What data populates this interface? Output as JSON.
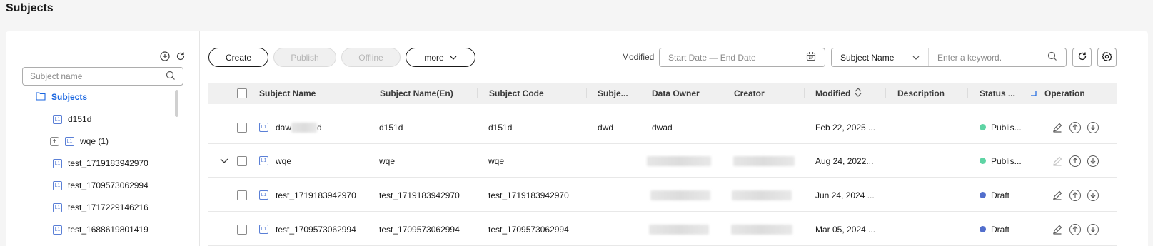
{
  "page": {
    "title": "Subjects"
  },
  "tree": {
    "search_placeholder": "Subject name",
    "root_label": "Subjects",
    "nodes": [
      {
        "label": "d151d",
        "expandable": false
      },
      {
        "label": "wqe (1)",
        "expandable": true
      },
      {
        "label": "test_1719183942970",
        "expandable": false
      },
      {
        "label": "test_1709573062994",
        "expandable": false
      },
      {
        "label": "test_1717229146216",
        "expandable": false
      },
      {
        "label": "test_1688619801419",
        "expandable": false
      }
    ],
    "node_icon_text": "L1"
  },
  "toolbar": {
    "create_label": "Create",
    "publish_label": "Publish",
    "offline_label": "Offline",
    "more_label": "more",
    "modified_label": "Modified",
    "date_placeholder": "Start Date — End Date",
    "filter_select": "Subject Name",
    "keyword_placeholder": "Enter a keyword."
  },
  "table": {
    "columns": {
      "name": "Subject Name",
      "name_en": "Subject Name(En)",
      "code": "Subject Code",
      "subject": "Subje...",
      "owner": "Data Owner",
      "creator": "Creator",
      "modified": "Modified",
      "description": "Description",
      "status": "Status ...",
      "operation": "Operation"
    },
    "rows": [
      {
        "name": "daw",
        "name_tail": "d",
        "name_en": "d151d",
        "code": "d151d",
        "subject": "dwd",
        "owner": "dwad",
        "creator": "",
        "modified": "Feb 22, 2025 ...",
        "status": "Publis...",
        "status_color": "#5ed4a4",
        "expand": false,
        "edit_enabled": true
      },
      {
        "name": "wqe",
        "name_en": "wqe",
        "code": "wqe",
        "subject": "",
        "owner": "",
        "creator": "",
        "modified": "Aug 24, 2022...",
        "status": "Publis...",
        "status_color": "#5ed4a4",
        "expand": true,
        "edit_enabled": false
      },
      {
        "name": "test_1719183942970",
        "name_en": "test_1719183942970",
        "code": "test_1719183942970",
        "subject": "",
        "owner": "",
        "creator": "",
        "modified": "Jun 24, 2024 ...",
        "status": "Draft",
        "status_color": "#526ecc",
        "expand": false,
        "edit_enabled": true
      },
      {
        "name": "test_1709573062994",
        "name_en": "test_1709573062994",
        "code": "test_1709573062994",
        "subject": "",
        "owner": "",
        "creator": "",
        "modified": "Mar 05, 2024 ...",
        "status": "Draft",
        "status_color": "#526ecc",
        "expand": false,
        "edit_enabled": true
      }
    ]
  },
  "icons": {
    "add": "plus-circle-icon",
    "refresh": "refresh-icon",
    "search": "search-icon",
    "calendar": "calendar-icon",
    "chevron": "chevron-down-icon",
    "settings": "gear-icon",
    "sort": "sort-icon",
    "filter": "filter-icon",
    "edit": "edit-icon",
    "publish": "publish-icon",
    "offline": "offline-icon"
  }
}
